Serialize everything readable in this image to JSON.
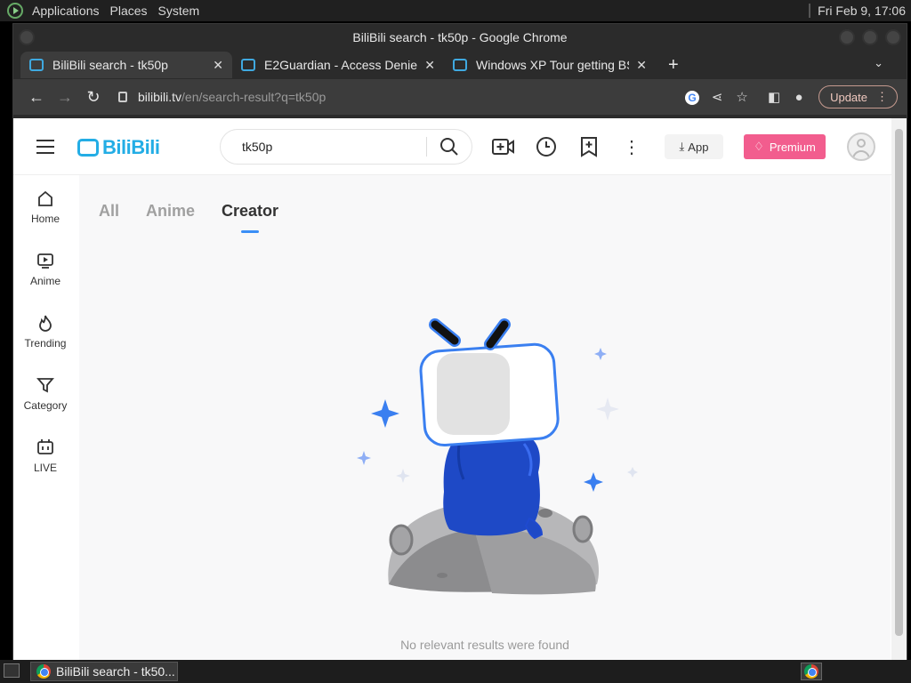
{
  "os_bar": {
    "menus": [
      "Applications",
      "Places",
      "System"
    ],
    "clock": "Fri Feb  9, 17:06"
  },
  "window": {
    "title": "BiliBili search - tk50p - Google Chrome"
  },
  "tabs": [
    {
      "title": "BiliBili search - tk50p",
      "active": true
    },
    {
      "title": "E2Guardian - Access Denied",
      "active": false
    },
    {
      "title": "Windows XP Tour getting BSO",
      "active": false
    }
  ],
  "address_bar": {
    "host": "bilibili.tv",
    "path": "/en/search-result?q=tk50p",
    "update_label": "Update"
  },
  "site": {
    "logo_text": "BiliBili",
    "search_value": "tk50p",
    "app_label": "App",
    "premium_label": "Premium"
  },
  "sidebar": {
    "items": [
      {
        "label": "Home",
        "icon": "home-icon"
      },
      {
        "label": "Anime",
        "icon": "anime-icon"
      },
      {
        "label": "Trending",
        "icon": "trending-icon"
      },
      {
        "label": "Category",
        "icon": "category-icon"
      },
      {
        "label": "LIVE",
        "icon": "live-icon"
      }
    ]
  },
  "filter_tabs": [
    {
      "label": "All",
      "active": false
    },
    {
      "label": "Anime",
      "active": false
    },
    {
      "label": "Creator",
      "active": true
    }
  ],
  "empty_state": {
    "message": "No relevant results were found"
  },
  "taskbar": {
    "item_label": "BiliBili search - tk50..."
  },
  "colors": {
    "brand": "#23ade5",
    "premium": "#f25d8e",
    "tab_indicator": "#3a8ef6"
  }
}
